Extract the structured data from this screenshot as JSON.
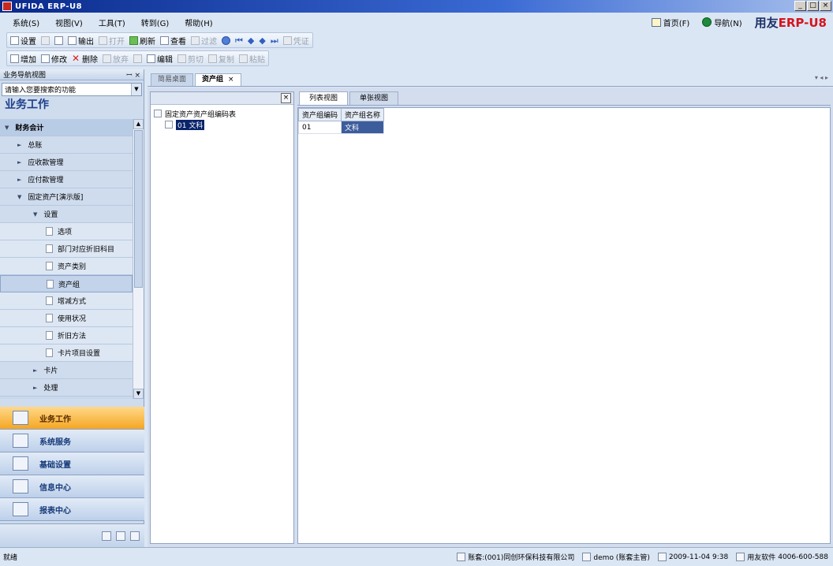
{
  "window": {
    "title": "UFIDA ERP-U8",
    "controls": [
      "_",
      "□",
      "×"
    ]
  },
  "menubar": {
    "items": [
      "系统(S)",
      "视图(V)",
      "工具(T)",
      "转到(G)",
      "帮助(H)"
    ],
    "home_label": "首页(F)",
    "logout_label": "导航(N)",
    "logo_text": "用友",
    "logo_erp": "ERP-U8"
  },
  "toolbar1": {
    "buttons": [
      {
        "label": "设置",
        "enabled": true
      },
      {
        "label": "",
        "enabled": true
      },
      {
        "label": "",
        "enabled": true
      },
      {
        "label": "输出",
        "enabled": true
      },
      {
        "label": "打开",
        "enabled": false
      },
      {
        "label": "刷新",
        "enabled": true
      },
      {
        "label": "查看",
        "enabled": true
      },
      {
        "label": "过滤",
        "enabled": false
      },
      {
        "label": "",
        "enabled": true
      },
      {
        "label": "",
        "enabled": true
      },
      {
        "label": "",
        "enabled": true
      },
      {
        "label": "",
        "enabled": true
      },
      {
        "label": "",
        "enabled": true
      },
      {
        "label": "凭证",
        "enabled": false
      }
    ]
  },
  "toolbar2": {
    "buttons": [
      {
        "label": "增加",
        "enabled": true
      },
      {
        "label": "修改",
        "enabled": true
      },
      {
        "label": "删除",
        "enabled": true
      },
      {
        "label": "放弃",
        "enabled": false
      },
      {
        "label": "",
        "enabled": false
      },
      {
        "label": "编辑",
        "enabled": true
      },
      {
        "label": "剪切",
        "enabled": false
      },
      {
        "label": "复制",
        "enabled": false
      },
      {
        "label": "粘贴",
        "enabled": false
      }
    ]
  },
  "nav": {
    "header": "业务导航视图",
    "pin": "ꟷ ×",
    "search_placeholder": "请输入您要搜索的功能",
    "title": "业务工作",
    "tree": [
      {
        "label": "财务会计",
        "level": 0,
        "caret": "▼"
      },
      {
        "label": "总账",
        "level": 1,
        "caret": "►"
      },
      {
        "label": "应收款管理",
        "level": 1,
        "caret": "►"
      },
      {
        "label": "应付款管理",
        "level": 1,
        "caret": "►"
      },
      {
        "label": "固定资产[演示版]",
        "level": 1,
        "caret": "▼"
      },
      {
        "label": "设置",
        "level": 2,
        "caret": "▼"
      },
      {
        "label": "选项",
        "level": 3
      },
      {
        "label": "部门对应折旧科目",
        "level": 3
      },
      {
        "label": "资产类别",
        "level": 3
      },
      {
        "label": "资产组",
        "level": 3,
        "selected": true
      },
      {
        "label": "增减方式",
        "level": 3
      },
      {
        "label": "使用状况",
        "level": 3
      },
      {
        "label": "折旧方法",
        "level": 3
      },
      {
        "label": "卡片项目设置",
        "level": 3
      },
      {
        "label": "卡片",
        "level": 2,
        "caret": "►"
      },
      {
        "label": "处理",
        "level": 2,
        "caret": "►"
      }
    ],
    "big_buttons": [
      {
        "label": "业务工作",
        "active": true
      },
      {
        "label": "系统服务",
        "active": false
      },
      {
        "label": "基础设置",
        "active": false
      },
      {
        "label": "信息中心",
        "active": false
      },
      {
        "label": "报表中心",
        "active": false
      }
    ]
  },
  "tabs": [
    {
      "label": "简易桌面",
      "active": false
    },
    {
      "label": "资产组",
      "active": true,
      "close": "×"
    }
  ],
  "tab_nav": "▾ ◂ ▸",
  "left_panel": {
    "close": "×",
    "root": "固定资产资产组编码表",
    "child_code": "01",
    "child_name": "文科"
  },
  "right_panel": {
    "tabs": [
      {
        "label": "列表视图",
        "active": true
      },
      {
        "label": "单张视图",
        "active": false
      }
    ],
    "columns": [
      "资产组编码",
      "资产组名称"
    ],
    "rows": [
      [
        "01",
        "文科"
      ]
    ]
  },
  "status": {
    "left": "就绪",
    "account": "账套:(001)同创环保科技有限公司",
    "user": "demo (账套主管)",
    "date": "2009-11-04 9:38",
    "company": "用友软件",
    "phone": "4006-600-588"
  }
}
